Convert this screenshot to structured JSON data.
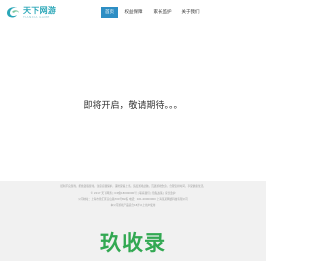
{
  "logo": {
    "title": "天下网游",
    "subtitle": "TIANXIA GAME"
  },
  "nav": {
    "items": [
      {
        "label": "首页",
        "active": true
      },
      {
        "label": "权益保障",
        "active": false
      },
      {
        "label": "家长监护",
        "active": false
      },
      {
        "label": "关于我们",
        "active": false
      }
    ]
  },
  "main": {
    "message": "即将开启，敬请期待。。。"
  },
  "footer": {
    "lines": [
      "抵制不良游戏，拒绝盗版游戏。注意自我保护，谨防受骗上当。适度游戏益脑，沉迷游戏伤身。合理安排时间，享受健康生活。",
      "© 2017 天下网游 | ICP备18000000号 | 联系我们 | 隐私政策 | 家长监护",
      "公司地址：上海市徐汇区宜山路700号B2栋 电话：021-00000000 上海某某网络科技有限公司",
      "本公司游戏产品适合18岁以上用户使用"
    ],
    "watermark": "玖收录"
  },
  "colors": {
    "brand": "#2ba7b8",
    "nav_active": "#2d8ec4",
    "footer_bg": "#f1f1f1",
    "watermark": "#32a852"
  }
}
